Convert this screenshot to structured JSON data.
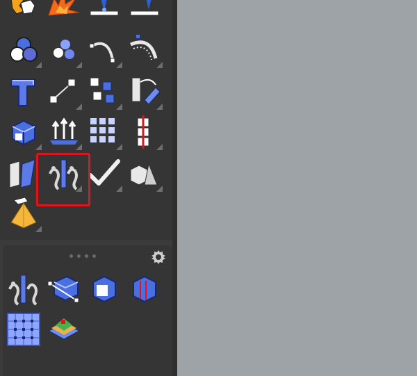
{
  "workspace": {
    "background_color": "#9ea3a8"
  },
  "panel": {
    "background_color": "#3b3b3b"
  },
  "toolbar_upper": {
    "tools": [
      {
        "id": "puzzle-tool",
        "icon": "puzzle-pieces-icon",
        "has_flyout": false
      },
      {
        "id": "explode-tool",
        "icon": "explode-icon",
        "has_flyout": false
      },
      {
        "id": "line-tool",
        "icon": "line-tool-icon",
        "has_flyout": false
      },
      {
        "id": "underline-tool",
        "icon": "underline-tool-icon",
        "has_flyout": false
      },
      {
        "id": "materials-tool",
        "icon": "colored-spheres-icon",
        "has_flyout": true
      },
      {
        "id": "group-spheres-tool",
        "icon": "spheres-group-icon",
        "has_flyout": true
      },
      {
        "id": "arc-tool",
        "icon": "arc-icon",
        "has_flyout": true
      },
      {
        "id": "offset-arc-tool",
        "icon": "offset-arc-icon",
        "has_flyout": true
      },
      {
        "id": "text-3d-tool",
        "icon": "3d-text-icon",
        "has_flyout": false
      },
      {
        "id": "scale-tool",
        "icon": "scale-icon",
        "has_flyout": true
      },
      {
        "id": "component-tool",
        "icon": "components-icon",
        "has_flyout": true
      },
      {
        "id": "paint-bucket-tool",
        "icon": "paint-bucket-icon",
        "has_flyout": true
      },
      {
        "id": "push-pull-tool",
        "icon": "solid-box-icon",
        "has_flyout": true
      },
      {
        "id": "extrude-tool",
        "icon": "extrude-arrows-icon",
        "has_flyout": true
      },
      {
        "id": "array-tool",
        "icon": "grid-array-icon",
        "has_flyout": true
      },
      {
        "id": "section-stack-tool",
        "icon": "section-stack-icon",
        "has_flyout": true
      },
      {
        "id": "flip-tool",
        "icon": "flip-panels-icon",
        "has_flyout": false
      },
      {
        "id": "section-cut-tool",
        "icon": "section-cut-icon",
        "has_flyout": true
      },
      {
        "id": "checkmark-tool",
        "icon": "checkmark-icon",
        "has_flyout": true
      },
      {
        "id": "solids-tool",
        "icon": "solid-shapes-icon",
        "has_flyout": true
      },
      {
        "id": "pyramid-tool",
        "icon": "pyramid-icon",
        "has_flyout": true
      }
    ],
    "highlighted_tool": "section-cut-tool",
    "highlight_color": "#e0141b"
  },
  "toolbar_lower": {
    "header_icons": [
      "drag-handle-icon",
      "gear-icon"
    ],
    "tools": [
      {
        "id": "section-plane-tool",
        "icon": "section-plane-icon"
      },
      {
        "id": "section-box-tool",
        "icon": "section-box-icon"
      },
      {
        "id": "hollow-cube-tool",
        "icon": "hollow-cube-icon"
      },
      {
        "id": "sliced-cube-tool",
        "icon": "sliced-cube-icon"
      },
      {
        "id": "grid-select-tool",
        "icon": "grid-select-icon",
        "active": true
      },
      {
        "id": "terrain-layers-tool",
        "icon": "terrain-layers-icon"
      }
    ]
  }
}
